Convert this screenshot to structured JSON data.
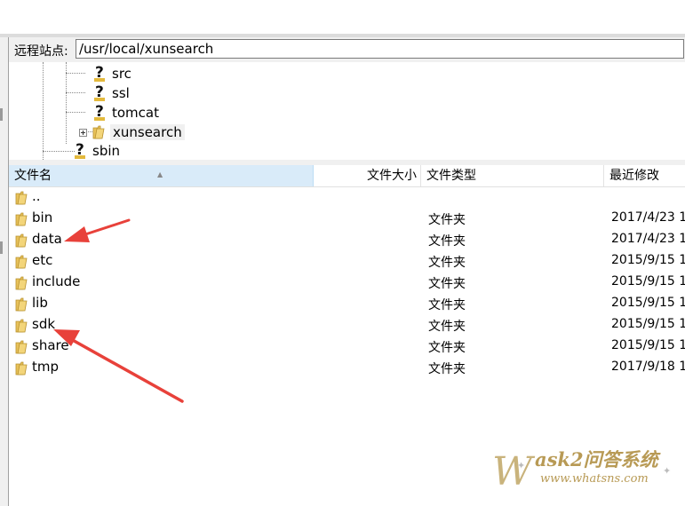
{
  "remote_path": {
    "label": "远程站点:",
    "value": "/usr/local/xunsearch"
  },
  "tree": {
    "items": [
      {
        "label": "src",
        "icon": "unknown-folder-icon"
      },
      {
        "label": "ssl",
        "icon": "unknown-folder-icon"
      },
      {
        "label": "tomcat",
        "icon": "unknown-folder-icon"
      },
      {
        "label": "xunsearch",
        "icon": "folder-icon",
        "selected": true,
        "expandable": true
      },
      {
        "label": "sbin",
        "icon": "unknown-folder-icon"
      }
    ]
  },
  "columns": {
    "name": "文件名",
    "size": "文件大小",
    "type": "文件类型",
    "modified": "最近修改"
  },
  "files": [
    {
      "name": "..",
      "type": "",
      "modified": ""
    },
    {
      "name": "bin",
      "type": "文件夹",
      "modified": "2017/4/23 1"
    },
    {
      "name": "data",
      "type": "文件夹",
      "modified": "2017/4/23 1"
    },
    {
      "name": "etc",
      "type": "文件夹",
      "modified": "2015/9/15 1"
    },
    {
      "name": "include",
      "type": "文件夹",
      "modified": "2015/9/15 1"
    },
    {
      "name": "lib",
      "type": "文件夹",
      "modified": "2015/9/15 1"
    },
    {
      "name": "sdk",
      "type": "文件夹",
      "modified": "2015/9/15 1"
    },
    {
      "name": "share",
      "type": "文件夹",
      "modified": "2015/9/15 1"
    },
    {
      "name": "tmp",
      "type": "文件夹",
      "modified": "2017/9/18 1"
    }
  ],
  "watermark": {
    "main": "ask2问答系统",
    "sub": "www.whatsns.com",
    "letter": "W"
  },
  "colors": {
    "folder": "#e8c25a",
    "annotation_arrow": "#e8413a",
    "sorted_header": "#d9ebf9"
  }
}
